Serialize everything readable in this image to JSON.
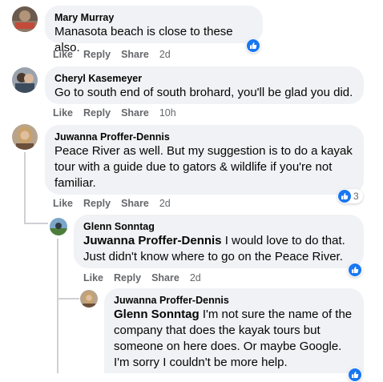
{
  "actions": {
    "like": "Like",
    "reply": "Reply",
    "share": "Share"
  },
  "comments": [
    {
      "author": "Mary Murray",
      "text": "Manasota beach is close to these also.",
      "time": "2d"
    },
    {
      "author": "Cheryl Kasemeyer",
      "text": "Go to south end of south brohard, you'll be glad you did.",
      "time": "10h"
    },
    {
      "author": "Juwanna Proffer-Dennis",
      "text_lines": [
        "Peace River as well. But my suggestion is to do a kayak",
        "tour with a guide due to gators & wildlife if you're not",
        "familiar."
      ],
      "time": "2d",
      "reaction_count": "3"
    },
    {
      "author": "Glenn Sonntag",
      "mention": "Juwanna Proffer-Dennis",
      "text_line1": " I would love to do that.",
      "text_line2": "Just didn't know where to go on the Peace River.",
      "time": "2d"
    },
    {
      "author": "Juwanna Proffer-Dennis",
      "mention": "Glenn Sonntag",
      "text_line1": " I'm not sure the name of the",
      "text_lines": [
        "company that does the kayak tours but",
        "someone on here does. Or maybe Google.",
        "I'm sorry I couldn't be more help."
      ]
    }
  ],
  "colors": {
    "bubble": "#f0f2f5",
    "like_blue": "#1877f2",
    "meta": "#65676b"
  },
  "icons": {
    "reaction": "thumbs-up-icon"
  }
}
